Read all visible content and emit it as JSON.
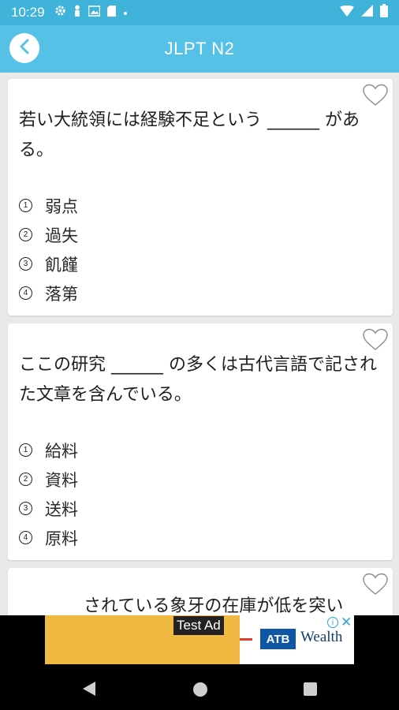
{
  "status_bar": {
    "time": "10:29"
  },
  "app_bar": {
    "title": "JLPT N2"
  },
  "questions": [
    {
      "text": "若い大統領には経験不足という ______ がある。",
      "options": [
        {
          "num": "1",
          "text": "弱点"
        },
        {
          "num": "2",
          "text": "過失"
        },
        {
          "num": "3",
          "text": "飢饉"
        },
        {
          "num": "4",
          "text": "落第"
        }
      ]
    },
    {
      "text": "ここの研究 ______ の多くは古代言語で記された文章を含んでいる。",
      "options": [
        {
          "num": "1",
          "text": "給料"
        },
        {
          "num": "2",
          "text": "資料"
        },
        {
          "num": "3",
          "text": "送料"
        },
        {
          "num": "4",
          "text": "原料"
        }
      ]
    },
    {
      "text": "されている象牙の在庫が低を突い"
    }
  ],
  "ad": {
    "label": "Test Ad",
    "brand": "ATB",
    "brand_text": "Wealth"
  },
  "colors": {
    "status_bar": "#3fb3da",
    "app_bar": "#55c1e7",
    "background": "#e9e9e9"
  }
}
